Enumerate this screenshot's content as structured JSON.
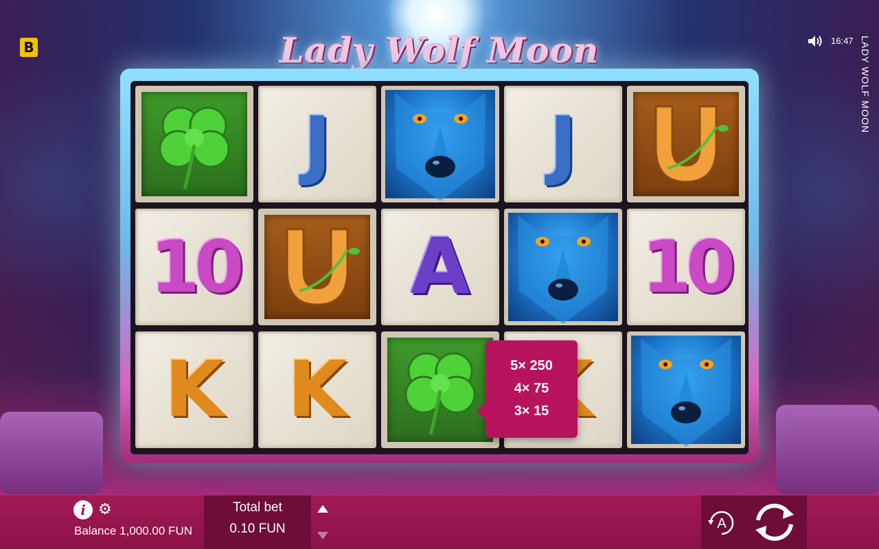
{
  "brand": {
    "logo_letter": "B"
  },
  "game": {
    "title": "Lady Wolf Moon",
    "side_title": "LADY WOLF MOON"
  },
  "status": {
    "time": "16:47",
    "sound_icon": "speaker-icon"
  },
  "reels": [
    [
      "clover",
      "J",
      "wolf",
      "J",
      "horseshoe"
    ],
    [
      "10",
      "horseshoe",
      "A",
      "wolf",
      "10"
    ],
    [
      "K",
      "K",
      "clover",
      "K",
      "wolf"
    ]
  ],
  "paytable_popup": {
    "symbol": "clover",
    "rows": [
      "5× 250",
      "4× 75",
      "3× 15"
    ]
  },
  "bottom_bar": {
    "balance": "Balance 1,000.00 FUN",
    "total_bet_label": "Total bet",
    "total_bet_value": "0.10 FUN",
    "autoplay_label": "A"
  }
}
